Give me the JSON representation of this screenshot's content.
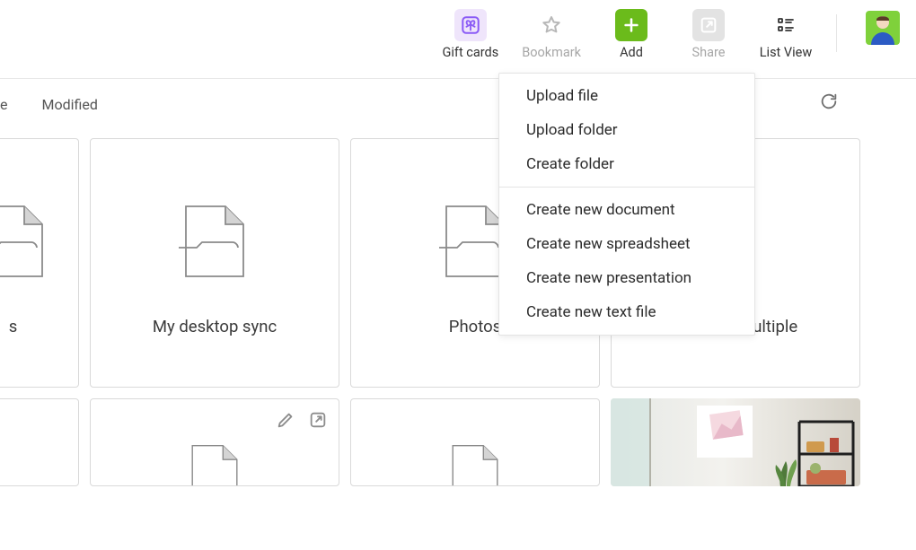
{
  "topbar": {
    "gift_cards": "Gift cards",
    "bookmark": "Bookmark",
    "add": "Add",
    "share": "Share",
    "list_view": "List View"
  },
  "dropdown": {
    "upload_file": "Upload file",
    "upload_folder": "Upload folder",
    "create_folder": "Create folder",
    "create_document": "Create new document",
    "create_spreadsheet": "Create new spreadsheet",
    "create_presentation": "Create new presentation",
    "create_text_file": "Create new text file"
  },
  "filters": {
    "partial_tab": "e",
    "modified": "Modified"
  },
  "folders": {
    "partial_left": "s",
    "my_desktop_sync": "My desktop sync",
    "photos": "Photos",
    "rename_multiple": "Rename multiple"
  }
}
